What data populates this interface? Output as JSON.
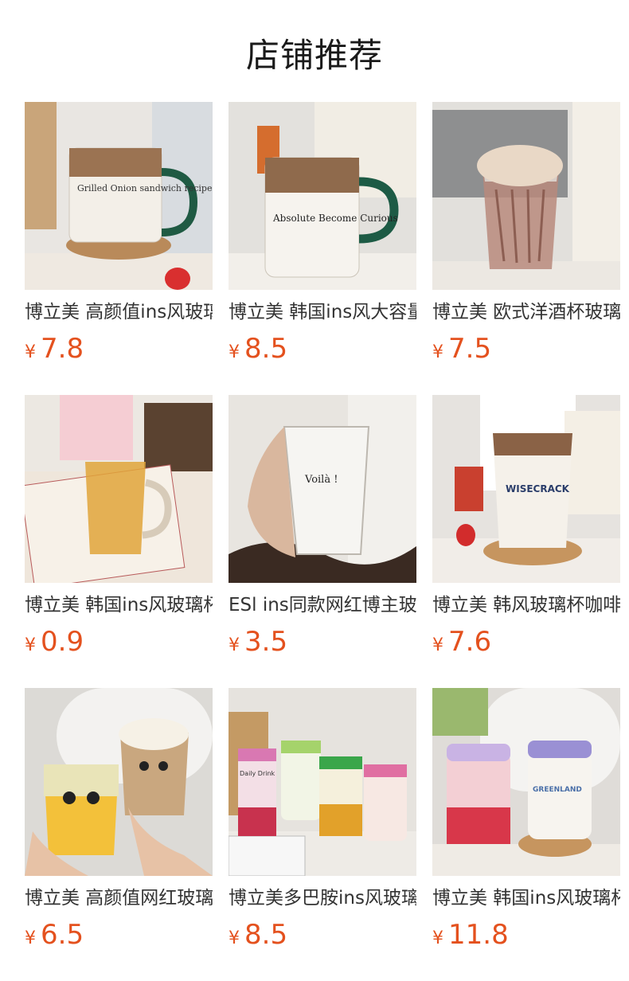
{
  "page": {
    "title": "店铺推荐"
  },
  "products": [
    {
      "name": "博立美 高颜值ins风玻璃杯",
      "currency": "¥",
      "price": "7.8",
      "image_icon": "glass-mug-green-handle-image",
      "cup_text": "Grilled Onion sandwich recipe"
    },
    {
      "name": "博立美 韩国ins风大容量玻璃杯",
      "currency": "¥",
      "price": "8.5",
      "image_icon": "glass-mug-absolute-image",
      "cup_text": "Absolute Become Curious"
    },
    {
      "name": "博立美 欧式洋酒杯玻璃杯",
      "currency": "¥",
      "price": "7.5",
      "image_icon": "twisted-whisky-glass-image",
      "cup_text": ""
    },
    {
      "name": "博立美 韩国ins风玻璃杯",
      "currency": "¥",
      "price": "0.9",
      "image_icon": "beer-mug-tea-image",
      "cup_text": ""
    },
    {
      "name": "ESl ins同款网红博主玻璃杯",
      "currency": "¥",
      "price": "3.5",
      "image_icon": "clear-glass-handwriting-image",
      "cup_text": "Voilà !"
    },
    {
      "name": "博立美 韩风玻璃杯咖啡杯",
      "currency": "¥",
      "price": "7.6",
      "image_icon": "wisecrack-latte-cup-image",
      "cup_text": "WISECRACK"
    },
    {
      "name": "博立美 高颜值网红玻璃杯",
      "currency": "¥",
      "price": "6.5",
      "image_icon": "cat-face-glasses-image",
      "cup_text": ""
    },
    {
      "name": "博立美多巴胺ins风玻璃杯",
      "currency": "¥",
      "price": "8.5",
      "image_icon": "daily-drink-jars-image",
      "cup_text": "Daily Drink"
    },
    {
      "name": "博立美 韩国ins风玻璃杯",
      "currency": "¥",
      "price": "11.8",
      "image_icon": "straw-lid-jars-image",
      "cup_text": "GREENLAND"
    }
  ]
}
